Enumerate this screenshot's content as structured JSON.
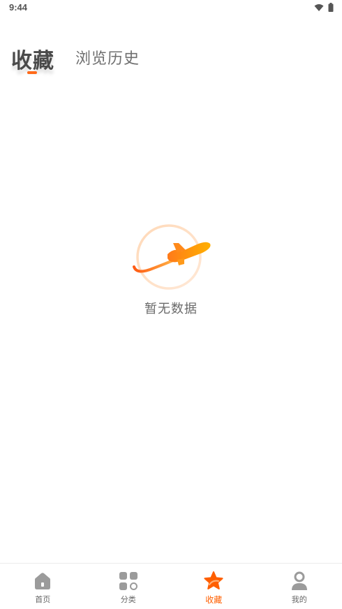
{
  "status_bar": {
    "time": "9:44"
  },
  "tabs": {
    "active_label": "收藏",
    "inactive_label": "浏览历史"
  },
  "empty_state": {
    "text": "暂无数据"
  },
  "bottom_nav": {
    "items": [
      {
        "label": "首页",
        "icon": "home-icon",
        "active": false
      },
      {
        "label": "分类",
        "icon": "category-icon",
        "active": false
      },
      {
        "label": "收藏",
        "icon": "star-icon",
        "active": true
      },
      {
        "label": "我的",
        "icon": "user-icon",
        "active": false
      }
    ]
  },
  "colors": {
    "accent": "#ff5f00",
    "inactive": "#9b9b9b"
  }
}
